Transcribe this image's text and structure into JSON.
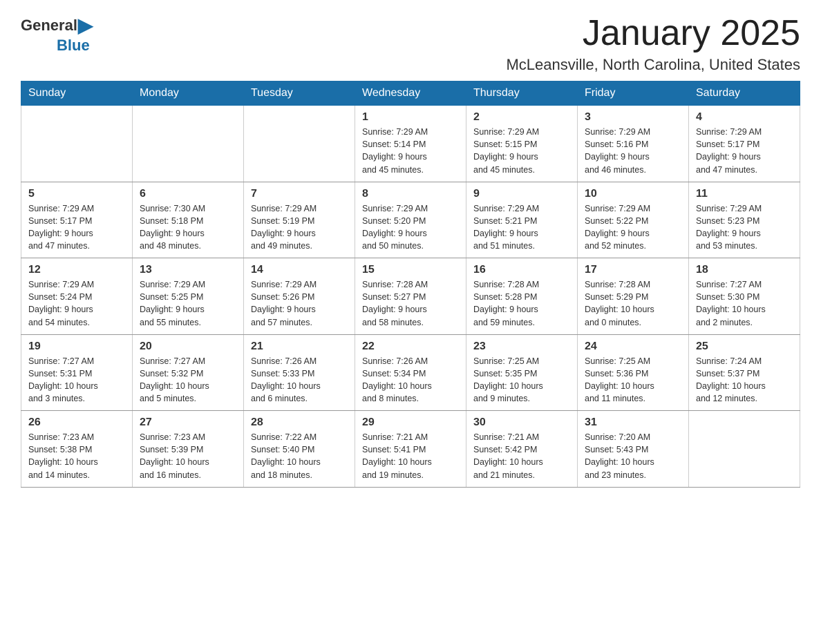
{
  "logo": {
    "general": "General",
    "blue": "Blue"
  },
  "header": {
    "title": "January 2025",
    "location": "McLeansville, North Carolina, United States"
  },
  "weekdays": [
    "Sunday",
    "Monday",
    "Tuesday",
    "Wednesday",
    "Thursday",
    "Friday",
    "Saturday"
  ],
  "weeks": [
    [
      {
        "day": "",
        "info": ""
      },
      {
        "day": "",
        "info": ""
      },
      {
        "day": "",
        "info": ""
      },
      {
        "day": "1",
        "info": "Sunrise: 7:29 AM\nSunset: 5:14 PM\nDaylight: 9 hours\nand 45 minutes."
      },
      {
        "day": "2",
        "info": "Sunrise: 7:29 AM\nSunset: 5:15 PM\nDaylight: 9 hours\nand 45 minutes."
      },
      {
        "day": "3",
        "info": "Sunrise: 7:29 AM\nSunset: 5:16 PM\nDaylight: 9 hours\nand 46 minutes."
      },
      {
        "day": "4",
        "info": "Sunrise: 7:29 AM\nSunset: 5:17 PM\nDaylight: 9 hours\nand 47 minutes."
      }
    ],
    [
      {
        "day": "5",
        "info": "Sunrise: 7:29 AM\nSunset: 5:17 PM\nDaylight: 9 hours\nand 47 minutes."
      },
      {
        "day": "6",
        "info": "Sunrise: 7:30 AM\nSunset: 5:18 PM\nDaylight: 9 hours\nand 48 minutes."
      },
      {
        "day": "7",
        "info": "Sunrise: 7:29 AM\nSunset: 5:19 PM\nDaylight: 9 hours\nand 49 minutes."
      },
      {
        "day": "8",
        "info": "Sunrise: 7:29 AM\nSunset: 5:20 PM\nDaylight: 9 hours\nand 50 minutes."
      },
      {
        "day": "9",
        "info": "Sunrise: 7:29 AM\nSunset: 5:21 PM\nDaylight: 9 hours\nand 51 minutes."
      },
      {
        "day": "10",
        "info": "Sunrise: 7:29 AM\nSunset: 5:22 PM\nDaylight: 9 hours\nand 52 minutes."
      },
      {
        "day": "11",
        "info": "Sunrise: 7:29 AM\nSunset: 5:23 PM\nDaylight: 9 hours\nand 53 minutes."
      }
    ],
    [
      {
        "day": "12",
        "info": "Sunrise: 7:29 AM\nSunset: 5:24 PM\nDaylight: 9 hours\nand 54 minutes."
      },
      {
        "day": "13",
        "info": "Sunrise: 7:29 AM\nSunset: 5:25 PM\nDaylight: 9 hours\nand 55 minutes."
      },
      {
        "day": "14",
        "info": "Sunrise: 7:29 AM\nSunset: 5:26 PM\nDaylight: 9 hours\nand 57 minutes."
      },
      {
        "day": "15",
        "info": "Sunrise: 7:28 AM\nSunset: 5:27 PM\nDaylight: 9 hours\nand 58 minutes."
      },
      {
        "day": "16",
        "info": "Sunrise: 7:28 AM\nSunset: 5:28 PM\nDaylight: 9 hours\nand 59 minutes."
      },
      {
        "day": "17",
        "info": "Sunrise: 7:28 AM\nSunset: 5:29 PM\nDaylight: 10 hours\nand 0 minutes."
      },
      {
        "day": "18",
        "info": "Sunrise: 7:27 AM\nSunset: 5:30 PM\nDaylight: 10 hours\nand 2 minutes."
      }
    ],
    [
      {
        "day": "19",
        "info": "Sunrise: 7:27 AM\nSunset: 5:31 PM\nDaylight: 10 hours\nand 3 minutes."
      },
      {
        "day": "20",
        "info": "Sunrise: 7:27 AM\nSunset: 5:32 PM\nDaylight: 10 hours\nand 5 minutes."
      },
      {
        "day": "21",
        "info": "Sunrise: 7:26 AM\nSunset: 5:33 PM\nDaylight: 10 hours\nand 6 minutes."
      },
      {
        "day": "22",
        "info": "Sunrise: 7:26 AM\nSunset: 5:34 PM\nDaylight: 10 hours\nand 8 minutes."
      },
      {
        "day": "23",
        "info": "Sunrise: 7:25 AM\nSunset: 5:35 PM\nDaylight: 10 hours\nand 9 minutes."
      },
      {
        "day": "24",
        "info": "Sunrise: 7:25 AM\nSunset: 5:36 PM\nDaylight: 10 hours\nand 11 minutes."
      },
      {
        "day": "25",
        "info": "Sunrise: 7:24 AM\nSunset: 5:37 PM\nDaylight: 10 hours\nand 12 minutes."
      }
    ],
    [
      {
        "day": "26",
        "info": "Sunrise: 7:23 AM\nSunset: 5:38 PM\nDaylight: 10 hours\nand 14 minutes."
      },
      {
        "day": "27",
        "info": "Sunrise: 7:23 AM\nSunset: 5:39 PM\nDaylight: 10 hours\nand 16 minutes."
      },
      {
        "day": "28",
        "info": "Sunrise: 7:22 AM\nSunset: 5:40 PM\nDaylight: 10 hours\nand 18 minutes."
      },
      {
        "day": "29",
        "info": "Sunrise: 7:21 AM\nSunset: 5:41 PM\nDaylight: 10 hours\nand 19 minutes."
      },
      {
        "day": "30",
        "info": "Sunrise: 7:21 AM\nSunset: 5:42 PM\nDaylight: 10 hours\nand 21 minutes."
      },
      {
        "day": "31",
        "info": "Sunrise: 7:20 AM\nSunset: 5:43 PM\nDaylight: 10 hours\nand 23 minutes."
      },
      {
        "day": "",
        "info": ""
      }
    ]
  ]
}
